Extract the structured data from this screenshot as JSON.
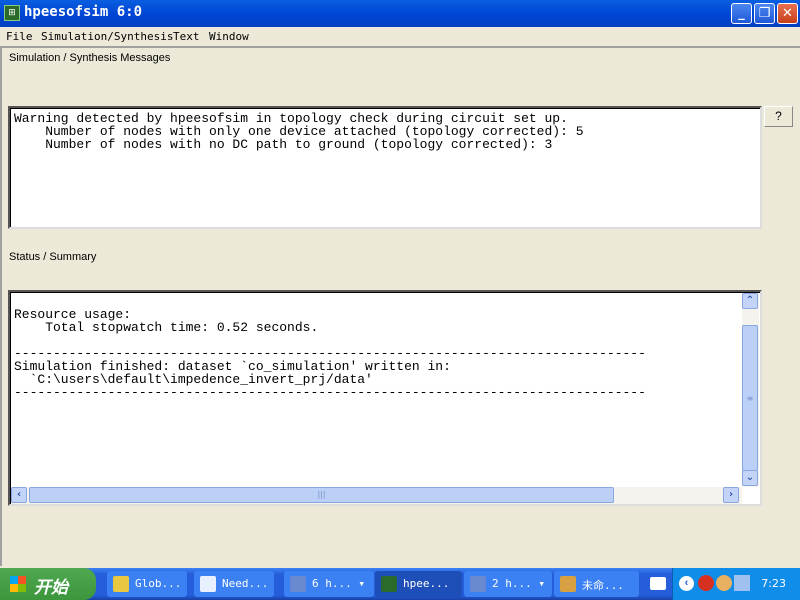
{
  "window": {
    "title": "hpeesofsim 6:0",
    "icon": "ads-app-icon"
  },
  "controls": {
    "minimize": "_",
    "restore": "❐",
    "close": "✕"
  },
  "menu": [
    "File",
    "Simulation/Synthesis",
    "Text",
    "Window"
  ],
  "messages": {
    "label": "Simulation / Synthesis Messages",
    "text": "Warning detected by hpeesofsim in topology check during circuit set up.\n    Number of nodes with only one device attached (topology corrected): 5\n    Number of nodes with no DC path to ground (topology corrected): 3",
    "help": "?"
  },
  "status": {
    "label": "Status / Summary",
    "text": "\nResource usage:\n    Total stopwatch time: 0.52 seconds.\n\n---------------------------------------------------------------------------------\nSimulation finished: dataset `co_simulation' written in:\n  `C:\\users\\default\\impedence_invert_prj/data'\n---------------------------------------------------------------------------------"
  },
  "taskbar": {
    "start": "开始",
    "tasks": [
      "Glob...",
      "Need...",
      "6 h...",
      "hpee...",
      "2 h...",
      "未命..."
    ],
    "clock": "7:23"
  }
}
